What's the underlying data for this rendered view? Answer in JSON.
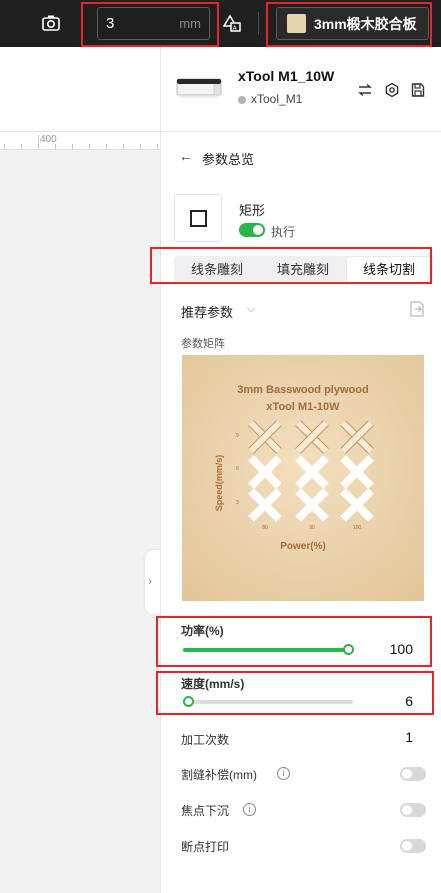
{
  "topbar": {
    "thickness_value": "3",
    "thickness_unit": "mm",
    "material_label": "3mm椴木胶合板",
    "camera_icon": "camera-icon",
    "shapes_icon": "shapes-icon"
  },
  "canvas": {
    "ruler_label": "400"
  },
  "device": {
    "name": "xTool M1_10W",
    "subname": "xTool_M1",
    "icons": [
      "swap-icon",
      "settings-icon",
      "save-icon"
    ]
  },
  "panel": {
    "back_title": "参数总览",
    "object_name": "矩形",
    "execute_label": "执行",
    "tabs": [
      {
        "label": "线条雕刻",
        "active": false
      },
      {
        "label": "填充雕刻",
        "active": false
      },
      {
        "label": "线条切割",
        "active": true
      }
    ],
    "recommended_label": "推荐参数",
    "matrix_label": "参数矩阵",
    "matrix": {
      "title_line1": "3mm Basswood plywood",
      "title_line2": "xTool M1-10W",
      "ylabel": "Speed(mm/s)",
      "xlabel": "Power(%)",
      "y_ticks": [
        "9",
        "6",
        "3"
      ],
      "x_ticks": [
        "80",
        "90",
        "100"
      ]
    },
    "power": {
      "label": "功率(%)",
      "value": "100",
      "fraction": 1.0
    },
    "speed": {
      "label": "速度(mm/s)",
      "value": "6",
      "fraction": 0.0
    },
    "passes": {
      "label": "加工次数",
      "value": "1"
    },
    "kerf": {
      "label": "割缝补偿(mm)",
      "enabled": false
    },
    "focus": {
      "label": "焦点下沉",
      "enabled": false
    },
    "resume": {
      "label": "断点打印",
      "enabled": false
    }
  },
  "colors": {
    "accent_green": "#2cb44c",
    "highlight_red": "#e8242b",
    "topbar_bg": "#1f1f20",
    "material_swatch": "#e8d4ae"
  }
}
